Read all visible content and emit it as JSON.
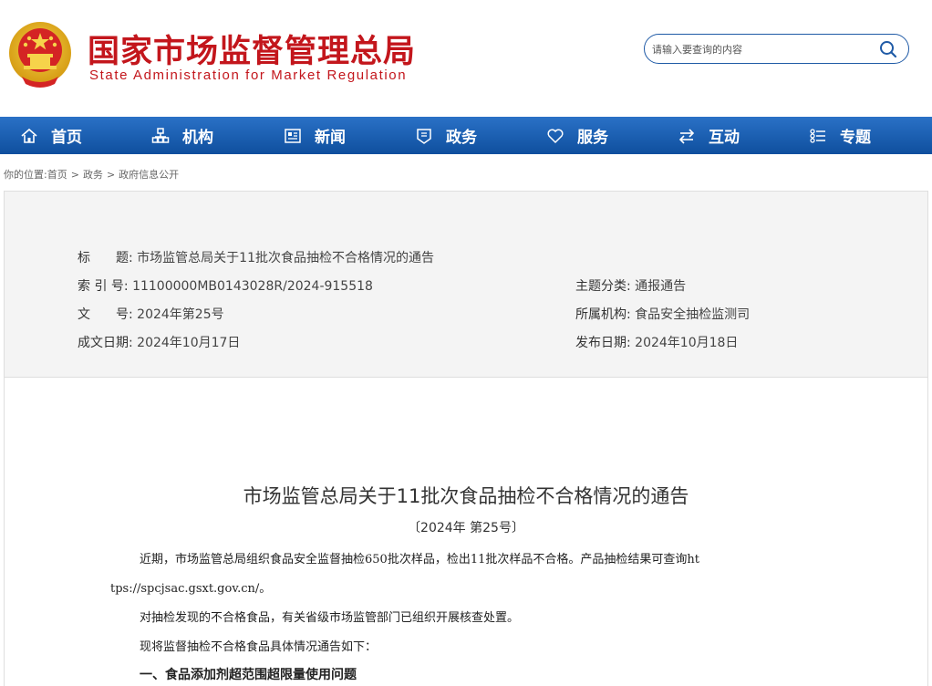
{
  "header": {
    "title_cn": "国家市场监督管理总局",
    "title_en": "State Administration for Market Regulation"
  },
  "search": {
    "placeholder": "请输入要查询的内容"
  },
  "nav": {
    "items": [
      {
        "label": "首页",
        "icon": "home-icon"
      },
      {
        "label": "机构",
        "icon": "org-chart-icon"
      },
      {
        "label": "新闻",
        "icon": "news-icon"
      },
      {
        "label": "政务",
        "icon": "government-icon"
      },
      {
        "label": "服务",
        "icon": "heart-icon"
      },
      {
        "label": "互动",
        "icon": "exchange-icon"
      },
      {
        "label": "专题",
        "icon": "list-icon"
      }
    ]
  },
  "breadcrumb": {
    "prefix": "你的位置:",
    "items": [
      "首页",
      "政务",
      "政府信息公开"
    ],
    "separator": ">"
  },
  "meta": {
    "title_label": "标　　题:",
    "title_value": "市场监管总局关于11批次食品抽检不合格情况的通告",
    "index_label": "索 引 号:",
    "index_value": "11100000MB0143028R/2024-915518",
    "topic_label": "主题分类:",
    "topic_value": "通报通告",
    "docno_label": "文　　号:",
    "docno_value": "2024年第25号",
    "org_label": "所属机构:",
    "org_value": "食品安全抽检监测司",
    "date_label": "成文日期:",
    "date_value": "2024年10月17日",
    "pub_label": "发布日期:",
    "pub_value": "2024年10月18日"
  },
  "article": {
    "title": "市场监管总局关于11批次食品抽检不合格情况的通告",
    "number": "〔2024年 第25号〕",
    "p1_line1": "近期，市场监管总局组织食品安全监督抽检650批次样品，检出11批次样品不合格。产品抽检结果可查询ht",
    "p1_line2": "tps://spcjsac.gsxt.gov.cn/。",
    "p2": "对抽检发现的不合格食品，有关省级市场监管部门已组织开展核查处置。",
    "p3": "现将监督抽检不合格食品具体情况通告如下：",
    "h1": "一、食品添加剂超范围超限量使用问题"
  },
  "colors": {
    "brand_red": "#c3161c",
    "nav_blue": "#1a5fb4"
  }
}
